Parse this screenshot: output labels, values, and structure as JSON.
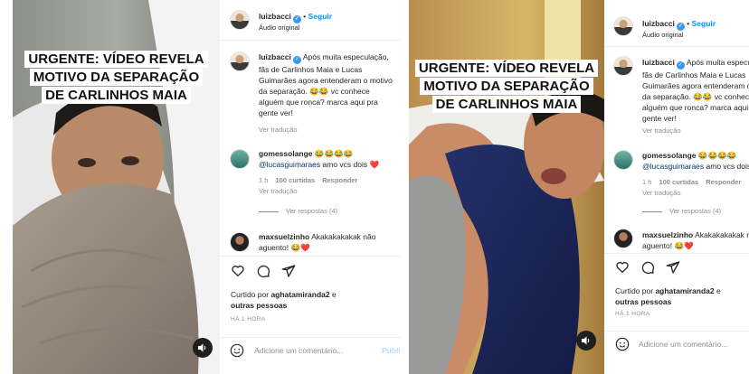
{
  "overlay_text": [
    "URGENTE: VÍDEO REVELA",
    "MOTIVO DA SEPARAÇÃO",
    "DE CARLINHOS MAIA"
  ],
  "post": {
    "username": "luizbacci",
    "follow_label": "Seguir",
    "audio_label": "Áudio original",
    "caption_user": "luizbacci",
    "caption_text": "Após muita especulação, fãs de Carlinhos Maia e Lucas Guimarães agora entenderam o motivo da separação. 😂😂 vc conhece alguém que ronca? marca aqui pra gente ver!",
    "see_translation": "Ver tradução",
    "comments": [
      {
        "user": "gomessolange",
        "emojis": "😂😂😂😂",
        "mention": "@lucasguimaraes",
        "text": " amo vcs dois ",
        "heart": "❤️",
        "time": "1 h",
        "likes": "100 curtidas",
        "reply": "Responder",
        "translate": "Ver tradução",
        "replies": "Ver respostas (4)"
      },
      {
        "user": "maxsuelzinho",
        "text": "Akakakakakak não aguento! 😂",
        "heart": "❤️"
      }
    ],
    "liked_prefix": "Curtido por",
    "liked_user": "aghatamiranda2",
    "liked_and": "e",
    "liked_others": "outras pessoas",
    "time_ago": "HÁ 1 HORA",
    "add_comment_placeholder": "Adicione um comentário...",
    "publish_label": "Publicar"
  },
  "icons": [
    "heart-icon",
    "comment-icon",
    "share-icon",
    "bookmark-icon",
    "emoji-icon",
    "sound-icon",
    "verified-icon"
  ],
  "colors": {
    "link": "#00376b",
    "follow": "#0095f6",
    "verified": "#3897f0",
    "muted": "#8e8e8e"
  }
}
